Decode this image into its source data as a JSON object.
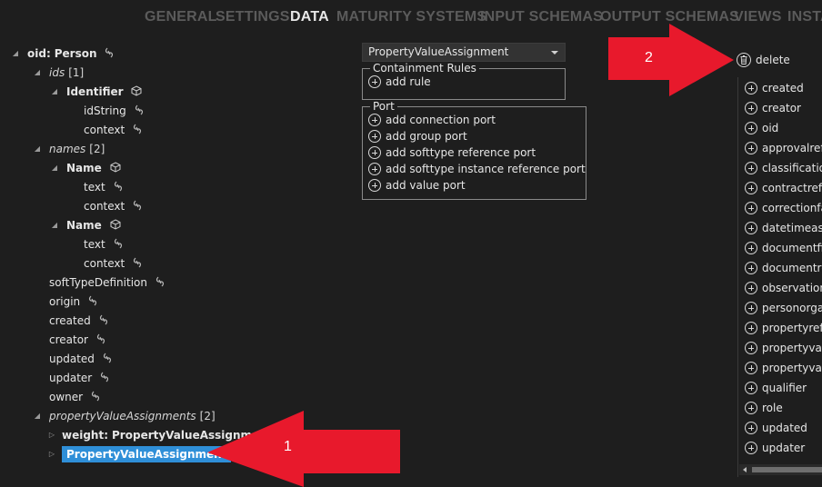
{
  "nav": {
    "tabs": [
      "GENERAL",
      "SETTINGS",
      "DATA",
      "MATURITY SYSTEMS",
      "INPUT SCHEMAS",
      "OUTPUT SCHEMAS",
      "VIEWS",
      "INSTA"
    ],
    "active": "DATA"
  },
  "tree": {
    "root": {
      "label": "oid:",
      "sublabel": "Person"
    },
    "ids": {
      "label": "ids",
      "count": "[1]"
    },
    "identifier": "Identifier",
    "idString": "idString",
    "context1": "context",
    "names": {
      "label": "names",
      "count": "[2]"
    },
    "name1": "Name",
    "text1": "text",
    "context2": "context",
    "name2": "Name",
    "text2": "text",
    "context3": "context",
    "softTypeDefinition": "softTypeDefinition",
    "origin": "origin",
    "created": "created",
    "creator": "creator",
    "updated": "updated",
    "updater": "updater",
    "owner": "owner",
    "propertyValueAssignments": {
      "label": "propertyValueAssignments",
      "count": "[2]"
    },
    "weight": {
      "label": "weight:",
      "sublabel": "PropertyValueAssignment"
    },
    "selected": "PropertyValueAssignment"
  },
  "middle": {
    "type_select": "PropertyValueAssignment",
    "containment": {
      "legend": "Containment Rules",
      "items": [
        "add rule"
      ]
    },
    "port": {
      "legend": "Port",
      "items": [
        "add connection port",
        "add group port",
        "add softtype reference port",
        "add softtype instance reference port",
        "add value port"
      ]
    }
  },
  "right": {
    "delete_label": "delete",
    "items": [
      "created",
      "creator",
      "oid",
      "approvalrefe",
      "classificatio",
      "contractrefer",
      "correctionfac",
      "datetimeassi",
      "documentfil",
      "documentre",
      "observationr",
      "personorgan",
      "propertyrefe",
      "propertyvalu",
      "propertyvalu",
      "qualifier",
      "role",
      "updated",
      "updater"
    ]
  },
  "annotations": {
    "arrow1": "1",
    "arrow2": "2",
    "color": "#e8192c"
  },
  "colors": {
    "background": "#1e1e1e",
    "selection": "#2f8fd8",
    "nav_inactive": "#5b5b5b",
    "nav_active": "#e8e8e8"
  }
}
